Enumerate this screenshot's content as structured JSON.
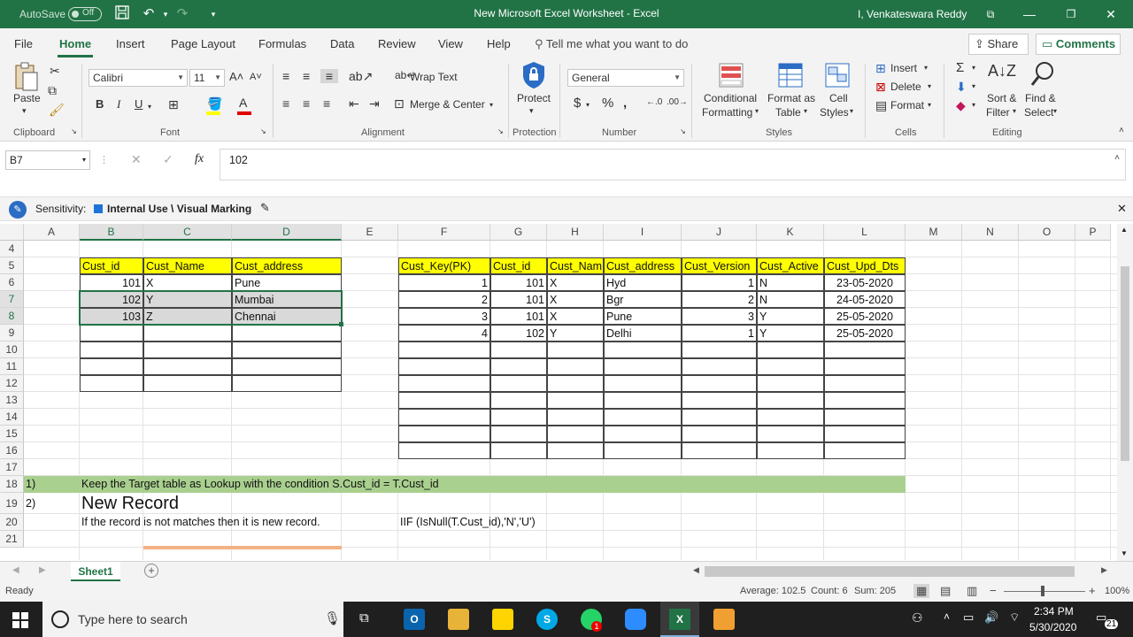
{
  "titlebar": {
    "autosave_label": "AutoSave",
    "autosave_state": "Off",
    "title": "New Microsoft Excel Worksheet  -  Excel",
    "user": "I, Venkateswara Reddy"
  },
  "ribbon_tabs": [
    "File",
    "Home",
    "Insert",
    "Page Layout",
    "Formulas",
    "Data",
    "Review",
    "View",
    "Help"
  ],
  "tell_me": "Tell me what you want to do",
  "share_label": "Share",
  "comments_label": "Comments",
  "ribbon": {
    "clipboard": {
      "paste": "Paste",
      "label": "Clipboard"
    },
    "font": {
      "name": "Calibri",
      "size": "11",
      "label": "Font",
      "bold": "B",
      "italic": "I",
      "underline": "U"
    },
    "alignment": {
      "wrap": "Wrap Text",
      "merge": "Merge & Center",
      "label": "Alignment"
    },
    "protection": {
      "protect": "Protect",
      "label": "Protection"
    },
    "number": {
      "format": "General",
      "label": "Number",
      "currency": "$",
      "percent": "%"
    },
    "styles": {
      "conditional1": "Conditional",
      "conditional2": "Formatting",
      "format_as1": "Format as",
      "format_as2": "Table",
      "cell1": "Cell",
      "cell2": "Styles",
      "label": "Styles"
    },
    "cells": {
      "insert": "Insert",
      "delete": "Delete",
      "format": "Format",
      "label": "Cells"
    },
    "editing": {
      "sort1": "Sort &",
      "sort2": "Filter",
      "find1": "Find &",
      "find2": "Select",
      "label": "Editing"
    }
  },
  "formula_bar": {
    "name_box": "B7",
    "fx": "fx",
    "value": "102"
  },
  "sensitivity": {
    "label": "Sensitivity:",
    "value": "Internal Use \\ Visual Marking"
  },
  "columns": [
    "A",
    "B",
    "C",
    "D",
    "E",
    "F",
    "G",
    "H",
    "I",
    "J",
    "K",
    "L",
    "M",
    "N",
    "O",
    "P"
  ],
  "rows": [
    "4",
    "5",
    "6",
    "7",
    "8",
    "9",
    "10",
    "11",
    "12",
    "13",
    "14",
    "15",
    "16",
    "17",
    "18",
    "19",
    "20",
    "21"
  ],
  "source_table": {
    "headers": [
      "Cust_id",
      "Cust_Name",
      "Cust_address"
    ],
    "rows": [
      [
        "101",
        "X",
        "Pune"
      ],
      [
        "102",
        "Y",
        "Mumbai"
      ],
      [
        "103",
        "Z",
        "Chennai"
      ]
    ]
  },
  "target_table": {
    "headers": [
      "Cust_Key(PK)",
      "Cust_id",
      "Cust_Nam",
      "Cust_address",
      "Cust_Version",
      "Cust_Active",
      "Cust_Upd_Dts"
    ],
    "rows": [
      [
        "1",
        "101",
        "X",
        "Hyd",
        "1",
        "N",
        "23-05-2020"
      ],
      [
        "2",
        "101",
        "X",
        "Bgr",
        "2",
        "N",
        "24-05-2020"
      ],
      [
        "3",
        "101",
        "X",
        "Pune",
        "3",
        "Y",
        "25-05-2020"
      ],
      [
        "4",
        "102",
        "Y",
        "Delhi",
        "1",
        "Y",
        "25-05-2020"
      ]
    ]
  },
  "notes": {
    "r18_num": "1)",
    "r18_text": "Keep the Target table as Lookup with the condition S.Cust_id = T.Cust_id",
    "r19_num": "2)",
    "r19_text": "New Record",
    "r20_text": "If the record is not matches then it is new record.",
    "r20_formula": "IIF (IsNull(T.Cust_id),'N','U')"
  },
  "sheet_tab": "Sheet1",
  "status": {
    "ready": "Ready",
    "average": "Average: 102.5",
    "count": "Count: 6",
    "sum": "Sum: 205",
    "zoom": "100%"
  },
  "taskbar": {
    "search": "Type here to search",
    "time": "2:34 PM",
    "date": "5/30/2020",
    "notif": "21"
  }
}
